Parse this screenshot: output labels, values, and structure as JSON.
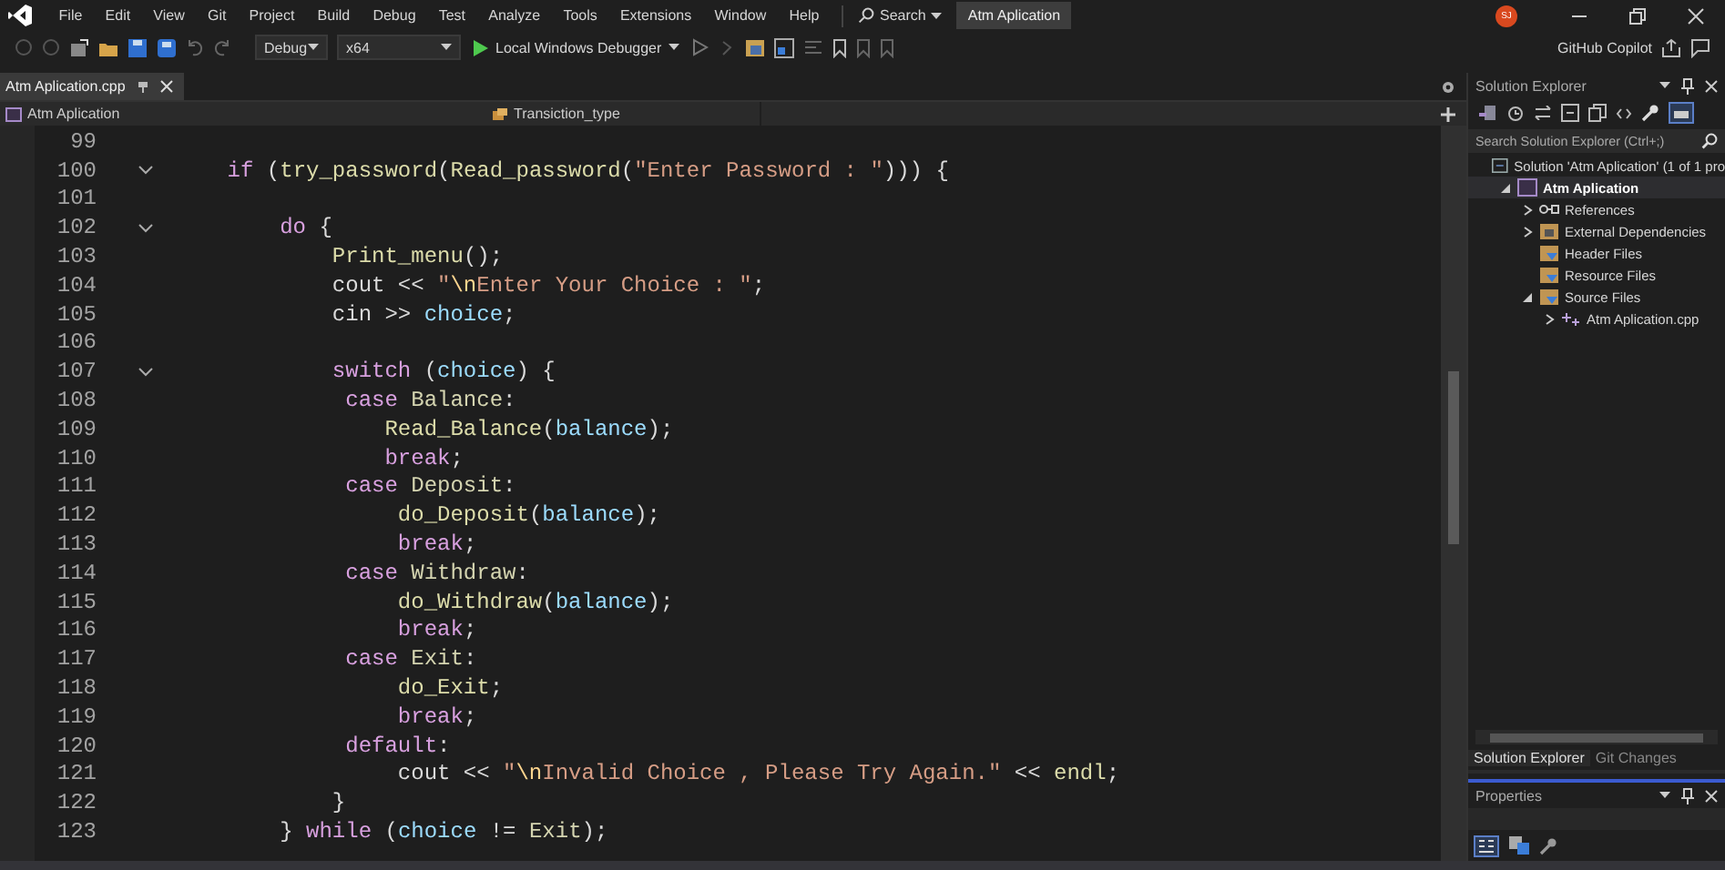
{
  "menu": [
    "File",
    "Edit",
    "View",
    "Git",
    "Project",
    "Build",
    "Debug",
    "Test",
    "Analyze",
    "Tools",
    "Extensions",
    "Window",
    "Help"
  ],
  "search": "Search",
  "window_title": "Atm Aplication",
  "avatar": "SJ",
  "toolbar": {
    "configuration": "Debug",
    "platform": "x64",
    "run": "Local Windows Debugger",
    "copilot": "GitHub Copilot"
  },
  "document_tabs": [
    {
      "label": "Atm Aplication.cpp",
      "selected": true
    }
  ],
  "navigation": {
    "project": "Atm Aplication",
    "member": "Transiction_type"
  },
  "code_lines": [
    {
      "number": "99"
    },
    {
      "number": "100",
      "foldable": true,
      "tokens": [
        {
          "text": "    if",
          "kind": "keyword"
        },
        {
          "text": " (",
          "kind": "plain"
        },
        {
          "text": "try_password",
          "kind": "function"
        },
        {
          "text": "(",
          "kind": "plain"
        },
        {
          "text": "Read_password",
          "kind": "function"
        },
        {
          "text": "(",
          "kind": "plain"
        },
        {
          "text": "\"Enter Password : \"",
          "kind": "string"
        },
        {
          "text": "))) {",
          "kind": "plain"
        }
      ]
    },
    {
      "number": "101"
    },
    {
      "number": "102",
      "foldable": true,
      "tokens": [
        {
          "text": "        do",
          "kind": "keyword"
        },
        {
          "text": " {",
          "kind": "plain"
        }
      ]
    },
    {
      "number": "103",
      "tokens": [
        {
          "text": "            Print_menu",
          "kind": "function"
        },
        {
          "text": "();",
          "kind": "plain"
        }
      ]
    },
    {
      "number": "104",
      "tokens": [
        {
          "text": "            cout << ",
          "kind": "plain"
        },
        {
          "text": "\"",
          "kind": "string"
        },
        {
          "text": "\\n",
          "kind": "escape"
        },
        {
          "text": "Enter Your Choice : \"",
          "kind": "string"
        },
        {
          "text": ";",
          "kind": "plain"
        }
      ]
    },
    {
      "number": "105",
      "tokens": [
        {
          "text": "            cin >> ",
          "kind": "plain"
        },
        {
          "text": "choice",
          "kind": "variable"
        },
        {
          "text": ";",
          "kind": "plain"
        }
      ]
    },
    {
      "number": "106"
    },
    {
      "number": "107",
      "foldable": true,
      "tokens": [
        {
          "text": "            switch",
          "kind": "keyword"
        },
        {
          "text": " (",
          "kind": "plain"
        },
        {
          "text": "choice",
          "kind": "variable"
        },
        {
          "text": ") {",
          "kind": "plain"
        }
      ]
    },
    {
      "number": "108",
      "tokens": [
        {
          "text": "             case",
          "kind": "keyword"
        },
        {
          "text": " Balance",
          "kind": "enum"
        },
        {
          "text": ":",
          "kind": "plain"
        }
      ]
    },
    {
      "number": "109",
      "tokens": [
        {
          "text": "                Read_Balance",
          "kind": "function"
        },
        {
          "text": "(",
          "kind": "plain"
        },
        {
          "text": "balance",
          "kind": "variable"
        },
        {
          "text": ");",
          "kind": "plain"
        }
      ]
    },
    {
      "number": "110",
      "tokens": [
        {
          "text": "                break",
          "kind": "keyword"
        },
        {
          "text": ";",
          "kind": "plain"
        }
      ]
    },
    {
      "number": "111",
      "tokens": [
        {
          "text": "             case",
          "kind": "keyword"
        },
        {
          "text": " Deposit",
          "kind": "enum"
        },
        {
          "text": ":",
          "kind": "plain"
        }
      ]
    },
    {
      "number": "112",
      "tokens": [
        {
          "text": "                 do_Deposit",
          "kind": "function"
        },
        {
          "text": "(",
          "kind": "plain"
        },
        {
          "text": "balance",
          "kind": "variable"
        },
        {
          "text": ");",
          "kind": "plain"
        }
      ]
    },
    {
      "number": "113",
      "tokens": [
        {
          "text": "                 break",
          "kind": "keyword"
        },
        {
          "text": ";",
          "kind": "plain"
        }
      ]
    },
    {
      "number": "114",
      "tokens": [
        {
          "text": "             case",
          "kind": "keyword"
        },
        {
          "text": " Withdraw",
          "kind": "enum"
        },
        {
          "text": ":",
          "kind": "plain"
        }
      ]
    },
    {
      "number": "115",
      "tokens": [
        {
          "text": "                 do_Withdraw",
          "kind": "function"
        },
        {
          "text": "(",
          "kind": "plain"
        },
        {
          "text": "balance",
          "kind": "variable"
        },
        {
          "text": ");",
          "kind": "plain"
        }
      ]
    },
    {
      "number": "116",
      "tokens": [
        {
          "text": "                 break",
          "kind": "keyword"
        },
        {
          "text": ";",
          "kind": "plain"
        }
      ]
    },
    {
      "number": "117",
      "tokens": [
        {
          "text": "             case",
          "kind": "keyword"
        },
        {
          "text": " Exit",
          "kind": "enum"
        },
        {
          "text": ":",
          "kind": "plain"
        }
      ]
    },
    {
      "number": "118",
      "tokens": [
        {
          "text": "                 do_Exit",
          "kind": "function"
        },
        {
          "text": ";",
          "kind": "plain"
        }
      ]
    },
    {
      "number": "119",
      "tokens": [
        {
          "text": "                 break",
          "kind": "keyword"
        },
        {
          "text": ";",
          "kind": "plain"
        }
      ]
    },
    {
      "number": "120",
      "tokens": [
        {
          "text": "             default",
          "kind": "keyword"
        },
        {
          "text": ":",
          "kind": "plain"
        }
      ]
    },
    {
      "number": "121",
      "tokens": [
        {
          "text": "                 cout << ",
          "kind": "plain"
        },
        {
          "text": "\"",
          "kind": "string"
        },
        {
          "text": "\\n",
          "kind": "escape"
        },
        {
          "text": "Invalid Choice , Please Try Again.\"",
          "kind": "string"
        },
        {
          "text": " << ",
          "kind": "plain"
        },
        {
          "text": "endl",
          "kind": "function"
        },
        {
          "text": ";",
          "kind": "plain"
        }
      ]
    },
    {
      "number": "122",
      "tokens": [
        {
          "text": "            }",
          "kind": "plain"
        }
      ]
    },
    {
      "number": "123",
      "tokens": [
        {
          "text": "        } ",
          "kind": "plain"
        },
        {
          "text": "while",
          "kind": "keyword"
        },
        {
          "text": " (",
          "kind": "plain"
        },
        {
          "text": "choice",
          "kind": "variable"
        },
        {
          "text": " != ",
          "kind": "plain"
        },
        {
          "text": "Exit",
          "kind": "enum"
        },
        {
          "text": ");",
          "kind": "plain"
        }
      ]
    }
  ],
  "solution_explorer": {
    "title": "Solution Explorer",
    "search_placeholder": "Search Solution Explorer (Ctrl+;)",
    "tree": [
      {
        "label": "Solution 'Atm Aplication' (1 of 1 pro",
        "kind": "solution",
        "selected": false,
        "children": [
          {
            "label": "Atm Aplication",
            "kind": "project",
            "selected": true,
            "expanded": true,
            "children": [
              {
                "label": "References",
                "kind": "references",
                "selected": false,
                "expanded": false
              },
              {
                "label": "External Dependencies",
                "kind": "dependencies",
                "selected": false,
                "expanded": false
              },
              {
                "label": "Header Files",
                "kind": "filter",
                "selected": false
              },
              {
                "label": "Resource Files",
                "kind": "filter",
                "selected": false
              },
              {
                "label": "Source Files",
                "kind": "filter",
                "selected": false,
                "expanded": true,
                "children": [
                  {
                    "label": "Atm Aplication.cpp",
                    "kind": "file",
                    "selected": false,
                    "expanded": false
                  }
                ]
              }
            ]
          }
        ]
      }
    ],
    "tabs": [
      {
        "label": "Solution Explorer",
        "selected": true
      },
      {
        "label": "Git Changes",
        "selected": false
      }
    ]
  },
  "properties": {
    "title": "Properties"
  }
}
